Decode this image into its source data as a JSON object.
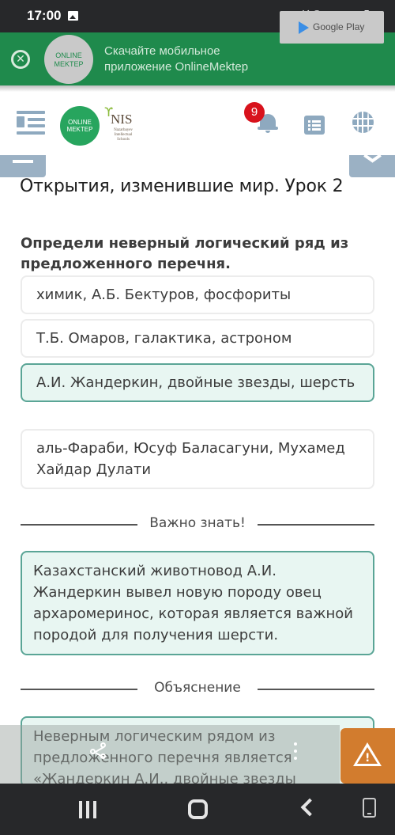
{
  "status_bar": {
    "time": "17:00",
    "icons": [
      "image-icon",
      "mute-icon",
      "wifi-icon",
      "signal-icon",
      "signal-icon",
      "battery-icon"
    ]
  },
  "app_banner": {
    "logo_line1": "ONLINE",
    "logo_line2": "MEKTEP",
    "text_line1": "Скачайте мобильное",
    "text_line2": "приложение OnlineMektep",
    "store_button": "Google Play"
  },
  "header": {
    "logo_line1": "ONLINE",
    "logo_line2": "MEKTEP",
    "nis_title": "NIS",
    "nis_subtitle": "Nazarbayev Intellectual Schools",
    "notification_count": "9"
  },
  "lesson": {
    "title": "Открытия, изменившие мир. Урок 2"
  },
  "question": {
    "text": "Определи неверный логический ряд из предложенного перечня.",
    "options": [
      {
        "label": "химик, А.Б. Бектуров, фосфориты",
        "selected": false
      },
      {
        "label": "Т.Б. Омаров, галактика, астроном",
        "selected": false
      },
      {
        "label": "А.И. Жандеркин, двойные звезды, шерсть",
        "selected": true
      },
      {
        "label": "аль-Фараби, Юсуф Баласагуни, Мухамед Хайдар Дулати",
        "selected": false
      }
    ]
  },
  "important": {
    "heading": "Важно знать!",
    "text": "Казахстанский животновод А.И. Жандеркин вывел новую породу овец архаромеринос, которая является важной породой для получения шерсти."
  },
  "explanation": {
    "heading": "Объяснение",
    "text": "Неверным логическим рядом из предложенного перечня является «Жандеркин А.И., двойные звезды"
  },
  "colors": {
    "banner_green": "#1f8a4c",
    "selected_bg": "#e8f6f2",
    "selected_border": "#5aa596",
    "badge_red": "#d8121c",
    "warning_orange": "#d27c2e",
    "icon_blue_gray": "#8ea9bf"
  }
}
